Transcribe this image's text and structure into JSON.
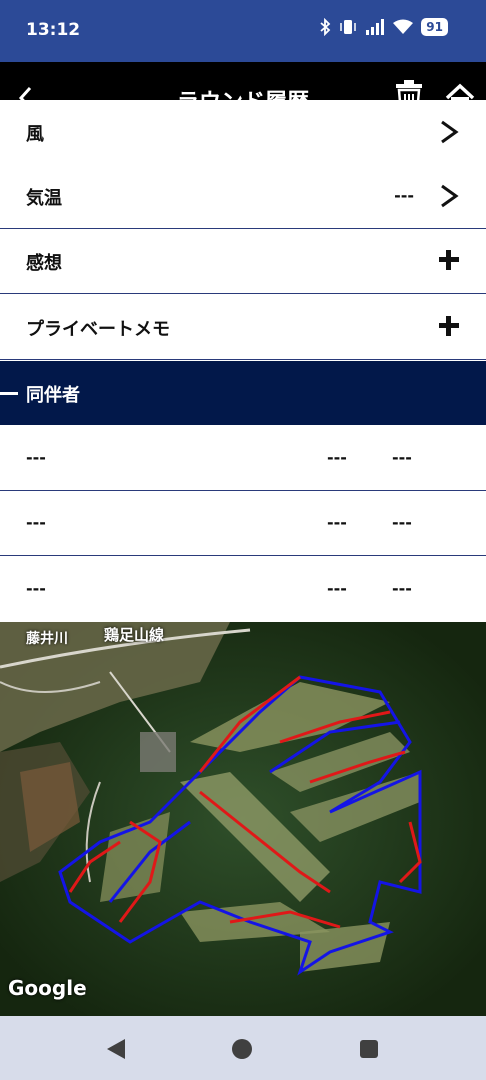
{
  "status_bar": {
    "time": "13:12",
    "battery": "91"
  },
  "app_bar": {
    "title": "ラウンド履歴"
  },
  "rows": [
    {
      "label": "風"
    },
    {
      "label": "気温",
      "value": "---"
    },
    {
      "label": "感想"
    },
    {
      "label": "プライベートメモ"
    }
  ],
  "companions": {
    "header": "同伴者",
    "rows": [
      {
        "name": "---",
        "col1": "---",
        "col2": "---"
      },
      {
        "name": "---",
        "col1": "---",
        "col2": "---"
      },
      {
        "name": "---",
        "col1": "---",
        "col2": "---"
      }
    ]
  },
  "map": {
    "road_label": "鶏足山線",
    "river_label": "藤井川",
    "watermark": "Google",
    "route_colors": {
      "a": "#e01818",
      "b": "#1414e6"
    }
  },
  "nav": {
    "back": "back-icon",
    "home": "home-circle-icon",
    "recents": "recents-square-icon"
  }
}
